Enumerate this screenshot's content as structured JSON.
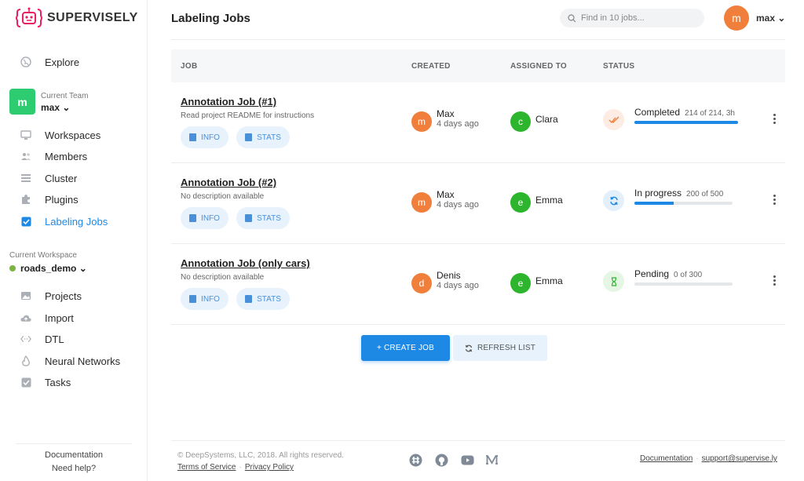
{
  "brand": {
    "name": "SUPERVISELY"
  },
  "sidebar": {
    "explore": "Explore",
    "team": {
      "caption": "Current Team",
      "avatar": "m",
      "name": "max ⌄"
    },
    "team_items": [
      {
        "label": "Workspaces",
        "icon": "monitor-icon"
      },
      {
        "label": "Members",
        "icon": "people-icon"
      },
      {
        "label": "Cluster",
        "icon": "server-icon"
      },
      {
        "label": "Plugins",
        "icon": "puzzle-icon"
      },
      {
        "label": "Labeling Jobs",
        "icon": "checkbox-icon",
        "active": true
      }
    ],
    "workspace": {
      "caption": "Current Workspace",
      "name": "roads_demo ⌄"
    },
    "workspace_items": [
      {
        "label": "Projects",
        "icon": "images-icon"
      },
      {
        "label": "Import",
        "icon": "cloud-upload-icon"
      },
      {
        "label": "DTL",
        "icon": "code-icon"
      },
      {
        "label": "Neural Networks",
        "icon": "flame-icon"
      },
      {
        "label": "Tasks",
        "icon": "tasks-icon"
      }
    ],
    "footer": {
      "docs": "Documentation",
      "help": "Need help?"
    }
  },
  "header": {
    "title": "Labeling Jobs",
    "search_placeholder": "Find in 10 jobs...",
    "user": {
      "avatar": "m",
      "name": "max ⌄"
    }
  },
  "table": {
    "columns": {
      "job": "JOB",
      "created": "CREATED",
      "assigned": "ASSIGNED TO",
      "status": "STATUS"
    },
    "rows": [
      {
        "title": "Annotation Job (#1)",
        "description": "Read project README for instructions",
        "info": "INFO",
        "stats": "STATS",
        "creator_initial": "m",
        "creator": "Max",
        "created_ago": "4 days ago",
        "assignee_initial": "c",
        "assignee": "Clara",
        "status": "Completed",
        "count": "214 of 214, 3h",
        "progress": 1.0,
        "status_icon": "double-check-icon"
      },
      {
        "title": "Annotation Job (#2)",
        "description": "No description available",
        "info": "INFO",
        "stats": "STATS",
        "creator_initial": "m",
        "creator": "Max",
        "created_ago": "4 days ago",
        "assignee_initial": "e",
        "assignee": "Emma",
        "status": "In progress",
        "count": "200 of 500",
        "progress": 0.4,
        "status_icon": "sync-icon"
      },
      {
        "title": "Annotation Job (only cars)",
        "description": "No description available",
        "info": "INFO",
        "stats": "STATS",
        "creator_initial": "d",
        "creator": "Denis",
        "created_ago": "4 days ago",
        "assignee_initial": "e",
        "assignee": "Emma",
        "status": "Pending",
        "count": "0 of 300",
        "progress": 0.0,
        "status_icon": "hourglass-icon"
      }
    ]
  },
  "actions": {
    "create": "+  CREATE JOB",
    "refresh": "REFRESH LIST"
  },
  "footer": {
    "copyright": "© DeepSystems, LLC, 2018. All rights reserved.",
    "terms": "Terms of Service",
    "privacy": "Privacy Policy",
    "docs": "Documentation",
    "support": "support@supervise.ly"
  },
  "colors": {
    "accent": "#1e88e5",
    "avatar_orange": "#f07f3c",
    "avatar_green": "#2db52d",
    "team_green": "#2ecc71"
  }
}
